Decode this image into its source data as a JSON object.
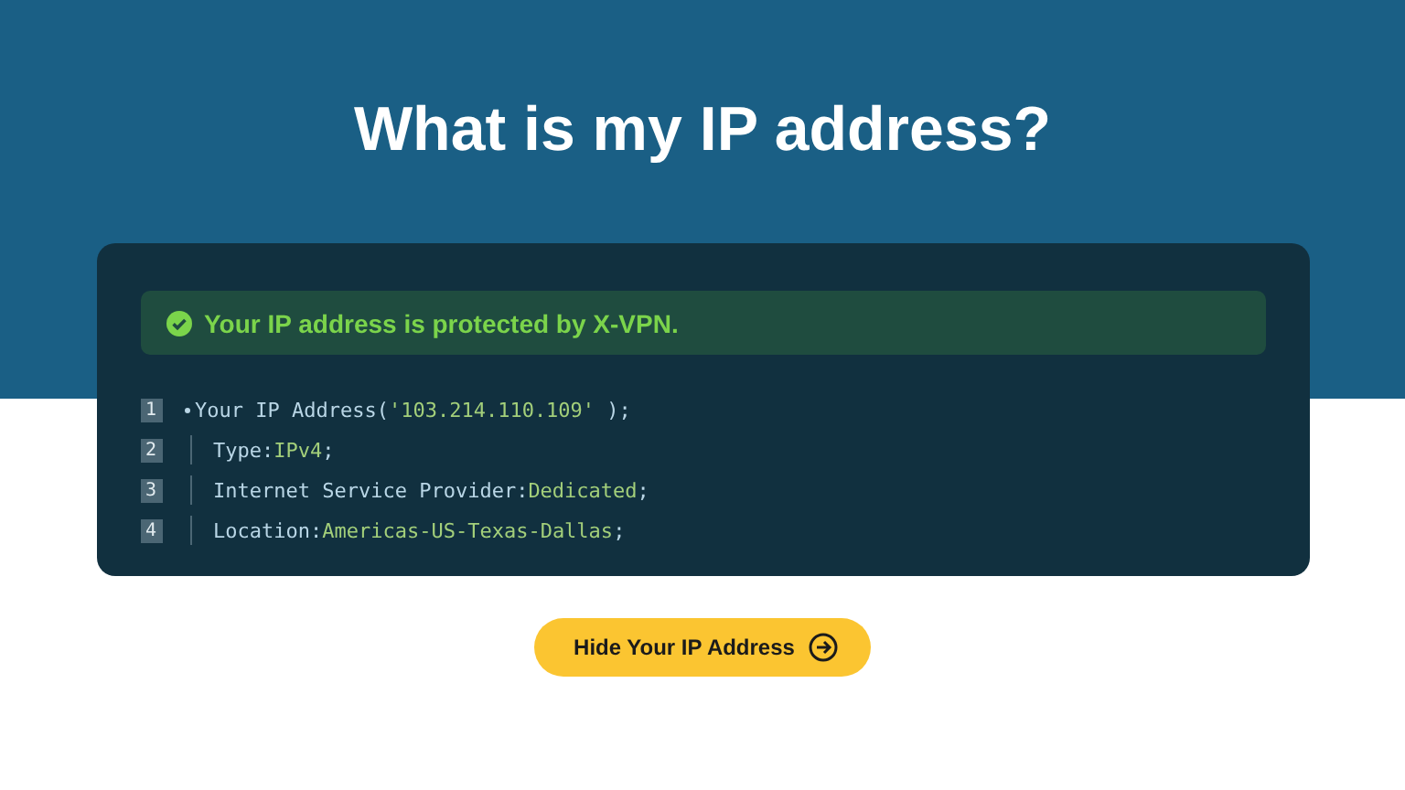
{
  "title": "What is my IP address?",
  "status": {
    "text": "Your IP address is protected by X-VPN."
  },
  "code_lines": [
    {
      "number": "1",
      "key": "Your IP Address(",
      "value": "'103.214.110.109'",
      "end": " );"
    },
    {
      "number": "2",
      "key": "Type:",
      "value": "IPv4",
      "end": ";"
    },
    {
      "number": "3",
      "key": "Internet Service Provider:",
      "value": "Dedicated",
      "end": ";"
    },
    {
      "number": "4",
      "key": "Location:",
      "value": "Americas-US-Texas-Dallas",
      "end": ";"
    }
  ],
  "button": {
    "label": "Hide Your IP Address"
  }
}
